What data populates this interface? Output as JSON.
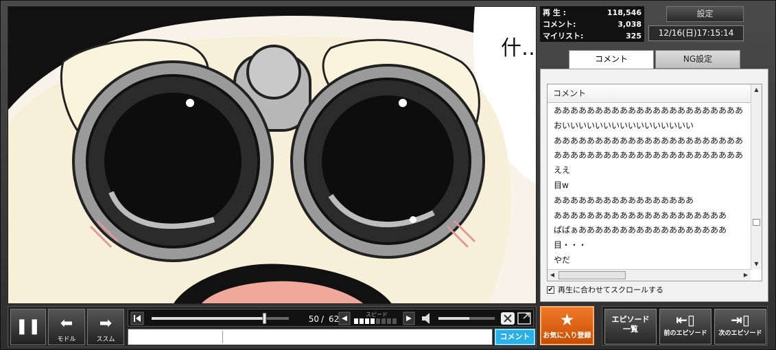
{
  "stats": {
    "views_label": "再 生 :",
    "views_value": "118,546",
    "comments_label": "コメント:",
    "comments_value": "3,038",
    "mylist_label": "マイリスト:",
    "mylist_value": "325"
  },
  "settings_label": "設定",
  "datetime": "12/16(日)17:15:14",
  "tabs": [
    {
      "label": "コメント",
      "active": true
    },
    {
      "label": "NG設定",
      "active": false
    }
  ],
  "comment_list": {
    "header": "コメント",
    "items": [
      "あああああああああああああああああああああああ",
      "おいいいいいいいいいいいいいいいい",
      "あああああああああああああああああああああああ",
      "あああああああああああああああああああああああ",
      "ええ",
      "目w",
      "あああああああああああああああああ",
      "あああああああああああああああああああああ",
      "ぱぱぁああああああああああああああああああ",
      "目・・・",
      "やだ"
    ]
  },
  "scroll_sync_label": "再生に合わせてスクロールする",
  "video_caption": "什……",
  "player": {
    "pause_icon": "pause-icon",
    "back_label": "モドル",
    "forward_label": "ススム",
    "page_current": "50",
    "page_sep": "/",
    "page_total": "62",
    "speed_label": "スピード",
    "progress": 0.82,
    "volume": 0.55,
    "speed_level": 0.5
  },
  "comment_submit_label": "コメント",
  "favorite_label": "お気に入り登録",
  "episode_list_label_1": "エピソード",
  "episode_list_label_2": "一覧",
  "prev_episode_label": "前のエピソード",
  "next_episode_label": "次のエピソード",
  "colors": {
    "accent_blue": "#2ab0e8",
    "favorite_orange": "#e8661a"
  }
}
